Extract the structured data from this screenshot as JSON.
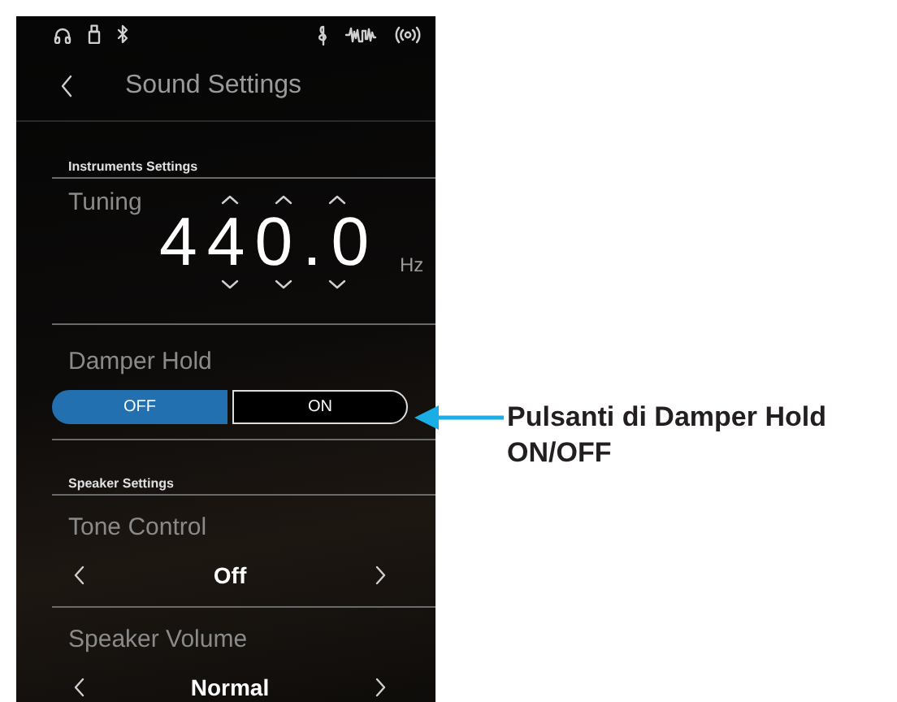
{
  "header": {
    "title": "Sound Settings"
  },
  "sections": [
    {
      "heading": "Instruments Settings",
      "items": [
        {
          "kind": "tuning",
          "label": "Tuning",
          "value": "440.0",
          "unit": "Hz"
        },
        {
          "kind": "toggle",
          "label": "Damper Hold",
          "options": [
            {
              "label": "OFF",
              "selected": true
            },
            {
              "label": "ON",
              "selected": false
            }
          ]
        }
      ]
    },
    {
      "heading": "Speaker Settings",
      "items": [
        {
          "kind": "selector",
          "label": "Tone Control",
          "value": "Off"
        },
        {
          "kind": "selector",
          "label": "Speaker Volume",
          "value": "Normal"
        }
      ]
    }
  ],
  "annotation": {
    "text": "Pulsanti di Damper Hold ON/OFF"
  }
}
